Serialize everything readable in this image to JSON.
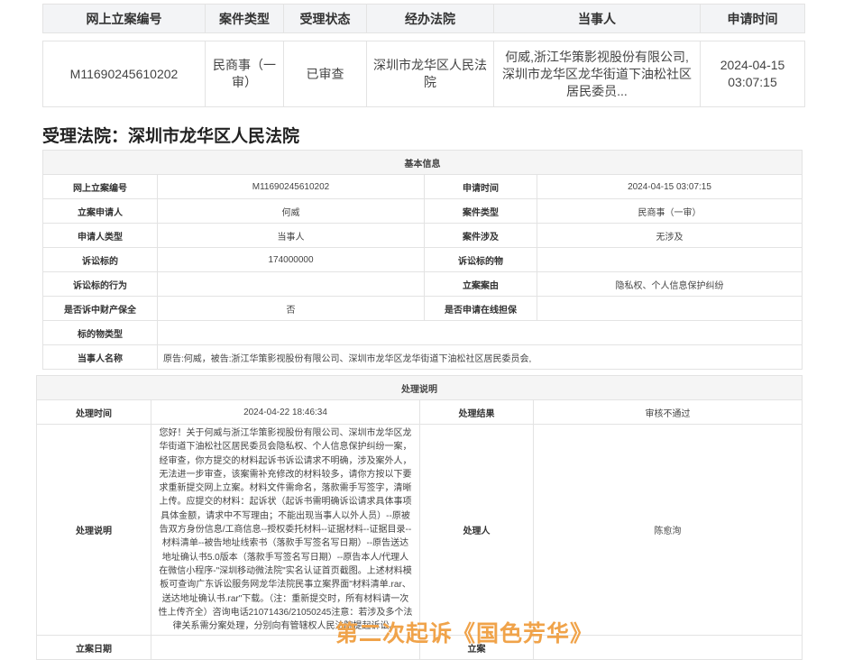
{
  "list_table": {
    "headers": [
      "网上立案编号",
      "案件类型",
      "受理状态",
      "经办法院",
      "当事人",
      "申请时间"
    ],
    "row": {
      "case_no": "M11690245610202",
      "case_type": "民商事（一审）",
      "status": "已审查",
      "court": "深圳市龙华区人民法院",
      "parties": "何威,浙江华策影视股份有限公司,深圳市龙华区龙华街道下油松社区居民委员...",
      "apply_date": "2024-04-15",
      "apply_time": "03:07:15"
    }
  },
  "court_heading": "受理法院：深圳市龙华区人民法院",
  "basic_info": {
    "title": "基本信息",
    "labels": {
      "case_no": "网上立案编号",
      "apply_time": "申请时间",
      "applicant": "立案申请人",
      "case_type": "案件类型",
      "applicant_type": "申请人类型",
      "case_involve": "案件涉及",
      "claim_amount": "诉讼标的",
      "claim_object": "诉讼标的物",
      "claim_behavior": "诉讼标的行为",
      "cause": "立案案由",
      "preservation": "是否诉中财产保全",
      "guarantee": "是否申请在线担保",
      "object_type": "标的物类型",
      "party_names": "当事人名称"
    },
    "values": {
      "case_no": "M11690245610202",
      "apply_time": "2024-04-15 03:07:15",
      "applicant": "何威",
      "case_type": "民商事（一审）",
      "applicant_type": "当事人",
      "case_involve": "无涉及",
      "claim_amount": "174000000",
      "claim_object": "",
      "claim_behavior": "",
      "cause": "隐私权、个人信息保护纠纷",
      "preservation": "否",
      "guarantee": "",
      "object_type": "",
      "party_names": "原告:何威，被告:浙江华策影视股份有限公司、深圳市龙华区龙华街道下油松社区居民委员会,"
    }
  },
  "processing": {
    "title": "处理说明",
    "labels": {
      "time": "处理时间",
      "result": "处理结果",
      "desc": "处理说明",
      "handler": "处理人",
      "filing_date": "立案日期",
      "row_label_2": "立案"
    },
    "values": {
      "time": "2024-04-22 18:46:34",
      "result": "审核不通过",
      "handler": "陈愈洵",
      "desc_lines": [
        "您好！关于何威与浙江华策影视股份有限公司、深圳市龙华区龙",
        "华街道下油松社区居民委员会隐私权、个人信息保护纠纷一案，",
        "经审查，你方提交的材料起诉书诉讼请求不明确，涉及案外人，",
        "无法进一步审查，该案需补充修改的材料较多，请你方按以下要",
        "求重新提交网上立案。材料文件需命名，落款需手写签字，清晰",
        "上传。应提交的材料：起诉状（起诉书需明确诉讼请求具体事项",
        "具体金额，请求中不写理由；不能出现当事人以外人员）--原被",
        "告双方身份信息/工商信息--授权委托材料--证据材料--证据目录--",
        "材料清单--被告地址线索书（落款手写签名写日期）--原告送达",
        "地址确认书5.0版本（落款手写签名写日期）--原告本人/代理人",
        "在微信小程序-\"深圳移动微法院\"实名认证首页截图。上述材料模",
        "板可查询广东诉讼服务网龙华法院民事立案界面\"材料清单.rar、",
        "送达地址确认书.rar\"下载。（注：重新提交时，所有材料请一次",
        "性上传齐全）咨询电话21071436/21050245注意：若涉及多个法",
        "律关系需分案处理，分别向有管辖权人民法院提起诉讼。"
      ]
    }
  },
  "watermark": "第二次起诉《国色芳华》"
}
